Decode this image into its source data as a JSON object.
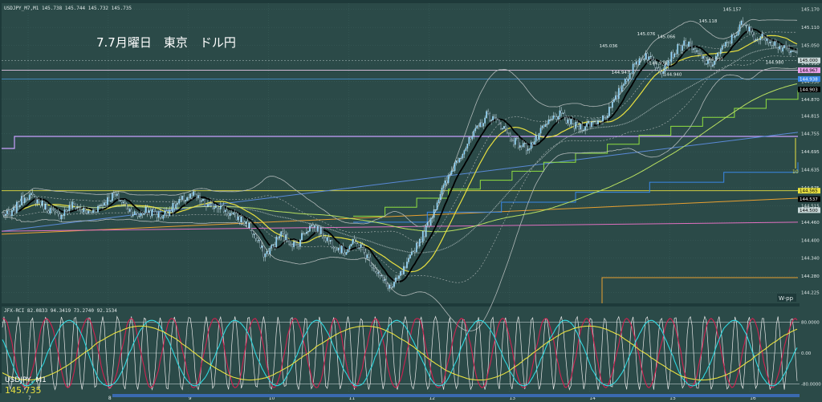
{
  "header": {
    "quote_line": "USDJPY_M7,M1  145.738 145.744 145.732 145.735",
    "title": "7.7月曜日　東京　ドル円"
  },
  "colors": {
    "background": "#2b4a48",
    "grid": "#3d615e",
    "candle_up": "#7fd0ff",
    "candle_down": "#1a2f3a",
    "ma_black": "#000000",
    "ma_yellow": "#e8e040",
    "ma_green": "#b8e060",
    "ma_gray": "#b0b8b8",
    "line_purple": "#c8a0ff",
    "line_blue": "#4a9adf",
    "line_orange": "#e8a030",
    "line_pink": "#e070c0",
    "line_step_green": "#90e040"
  },
  "chart_data": [
    {
      "type": "candlestick",
      "symbol": "USDJPY",
      "timeframe": "M1",
      "ylim": [
        144.2,
        145.18
      ],
      "y_ticks": [
        "145.170",
        "145.110",
        "145.050",
        "144.990",
        "144.930",
        "144.870",
        "144.815",
        "144.755",
        "144.695",
        "144.635",
        "144.575",
        "144.515",
        "144.460",
        "144.400",
        "144.340",
        "144.280",
        "144.225"
      ],
      "x_ticks": [
        "7",
        "8",
        "9",
        "10",
        "11",
        "12",
        "13",
        "14",
        "15",
        "16"
      ],
      "annotations": [
        {
          "label": "145.036",
          "price": 145.036,
          "x": 758
        },
        {
          "label": "145.076",
          "price": 145.076,
          "x": 805
        },
        {
          "label": "145.066",
          "price": 145.066,
          "x": 830
        },
        {
          "label": "145.118",
          "price": 145.118,
          "x": 882
        },
        {
          "label": "145.157",
          "price": 145.157,
          "x": 912
        },
        {
          "label": "144.947",
          "price": 144.947,
          "x": 773
        },
        {
          "label": "144.978",
          "price": 144.978,
          "x": 820
        },
        {
          "label": "144.940",
          "price": 144.94,
          "x": 838
        },
        {
          "label": "144.991",
          "price": 144.991,
          "x": 890
        },
        {
          "label": "144.980",
          "price": 144.98,
          "x": 965
        }
      ],
      "price_tags": [
        {
          "label": "145.000",
          "price": 145.0,
          "bg": "#c8d8d8",
          "fg": "#000000"
        },
        {
          "label": "144.967",
          "price": 144.967,
          "bg": "#e8a0e8",
          "fg": "#000000"
        },
        {
          "label": "144.938",
          "price": 144.938,
          "bg": "#3a88e8",
          "fg": "#ffffff"
        },
        {
          "label": "144.903",
          "price": 144.903,
          "bg": "#000000",
          "fg": "#ffffff"
        },
        {
          "label": "144.565",
          "price": 144.565,
          "bg": "#e8e040",
          "fg": "#000000"
        },
        {
          "label": "144.537",
          "price": 144.537,
          "bg": "#000000",
          "fg": "#ffffff"
        },
        {
          "label": "144.500",
          "price": 144.5,
          "bg": "#c8d8d8",
          "fg": "#000000"
        }
      ],
      "anchor_prices": [
        144.49,
        144.48,
        144.52,
        144.55,
        144.54,
        144.52,
        144.5,
        144.48,
        144.5,
        144.52,
        144.5,
        144.49,
        144.51,
        144.53,
        144.55,
        144.53,
        144.5,
        144.48,
        144.5,
        144.49,
        144.48,
        144.5,
        144.52,
        144.54,
        144.55,
        144.53,
        144.51,
        144.52,
        144.5,
        144.48,
        144.47,
        144.45,
        144.4,
        144.35,
        144.38,
        144.42,
        144.4,
        144.38,
        144.43,
        144.45,
        144.43,
        144.4,
        144.38,
        144.36,
        144.39,
        144.38,
        144.34,
        144.3,
        144.26,
        144.24,
        144.28,
        144.32,
        144.38,
        144.42,
        144.48,
        144.55,
        144.6,
        144.66,
        144.7,
        144.74,
        144.78,
        144.82,
        144.8,
        144.78,
        144.74,
        144.72,
        144.71,
        144.73,
        144.77,
        144.8,
        144.82,
        144.8,
        144.78,
        144.78,
        144.79,
        144.8,
        144.82,
        144.86,
        144.92,
        144.96,
        145.0,
        145.02,
        144.99,
        144.97,
        145.01,
        145.04,
        145.06,
        145.03,
        145.01,
        144.98,
        145.02,
        145.05,
        145.08,
        145.12,
        145.1,
        145.07,
        145.08,
        145.06,
        145.04,
        145.03,
        145.02
      ],
      "seed": 7,
      "oscillator": {
        "header": "JFX-RCI 82.0833 94.3419 73.2740 92.1534",
        "ylim": [
          -100,
          100
        ],
        "levels": [
          {
            "label": "80.0000",
            "value": 80
          },
          {
            "label": "0.00",
            "value": 0
          },
          {
            "label": "-80.0000",
            "value": -80
          }
        ],
        "series": [
          {
            "name": "",
            "color": "#e8e8e8",
            "period": 9,
            "amp": 95
          },
          {
            "name": "",
            "color": "#d02050",
            "period": 26,
            "amp": 90
          },
          {
            "name": "",
            "color": "#30d8e0",
            "period": 52,
            "amp": 85
          },
          {
            "name": "",
            "color": "#e8e040",
            "period": 140,
            "amp": 70
          }
        ]
      },
      "footer": {
        "symbol_label": "USDJPY, M1",
        "price_label": "145.735"
      },
      "side_labels": {
        "count": "10",
        "wpp": "W-pp"
      }
    }
  ]
}
